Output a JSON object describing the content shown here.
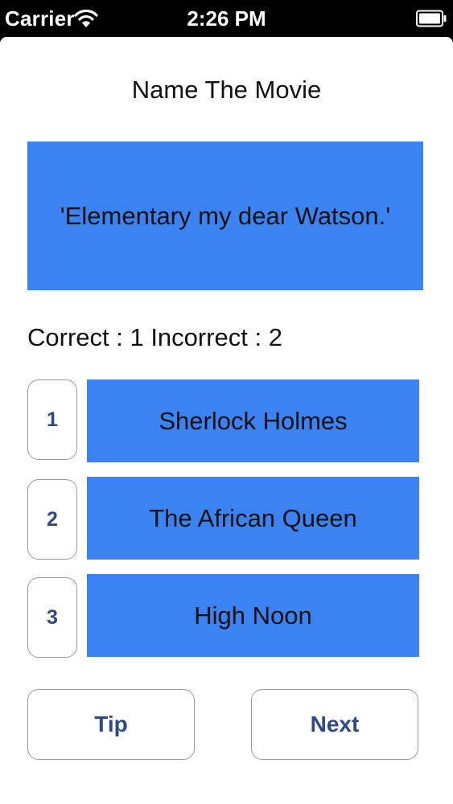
{
  "status_bar": {
    "carrier": "Carrier",
    "time": "2:26 PM",
    "wifi_icon": "wifi-icon",
    "battery_icon": "battery-icon"
  },
  "title": "Name The Movie",
  "quote": "'Elementary my dear Watson.'",
  "score": "Correct : 1 Incorrect : 2",
  "choices": [
    {
      "number": "1",
      "answer": "Sherlock Holmes"
    },
    {
      "number": "2",
      "answer": "The African Queen"
    },
    {
      "number": "3",
      "answer": "High Noon"
    }
  ],
  "buttons": {
    "tip": "Tip",
    "next": "Next"
  },
  "colors": {
    "accent_blue": "#3b82f2",
    "button_text": "#2d4a86",
    "status_bar_bg": "#000000"
  }
}
